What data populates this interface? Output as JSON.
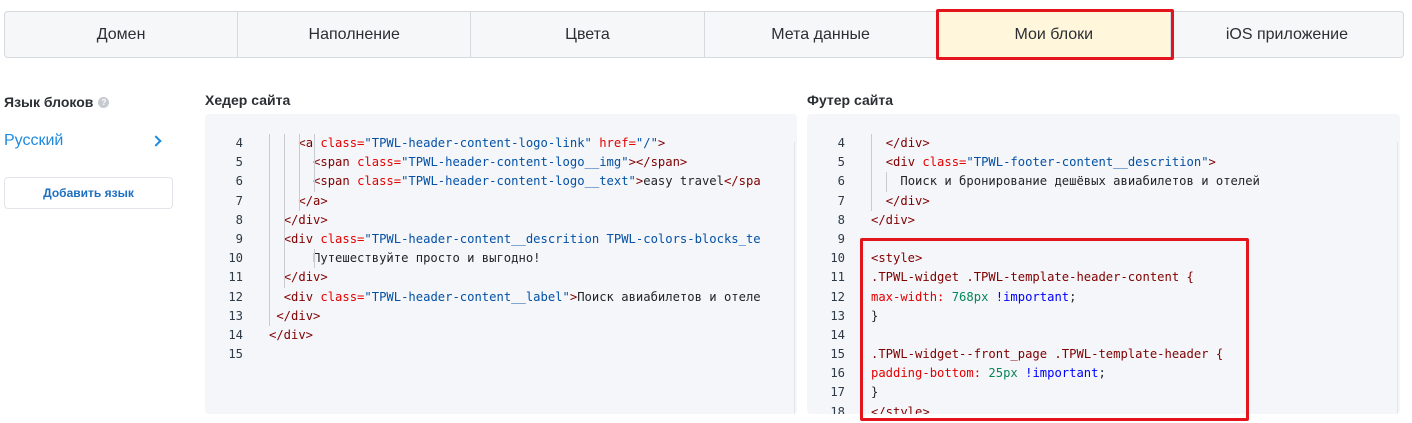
{
  "tabs": [
    {
      "label": "Домен"
    },
    {
      "label": "Наполнение"
    },
    {
      "label": "Цвета"
    },
    {
      "label": "Мета данные"
    },
    {
      "label": "Мои блоки"
    },
    {
      "label": "iOS приложение"
    }
  ],
  "active_tab": "Мои блоки",
  "left": {
    "title": "Язык блоков",
    "help": "?",
    "language": "Русский",
    "add_button": "Добавить язык"
  },
  "header_editor": {
    "title": "Хедер сайта",
    "lines": [
      {
        "n": "4",
        "segs": [
          [
            "    ",
            ""
          ],
          [
            "<a ",
            "tg"
          ],
          [
            "class=",
            "at"
          ],
          [
            "\"TPWL-header-content-logo-link\" ",
            "av"
          ],
          [
            "href=",
            "at"
          ],
          [
            "\"/\"",
            "av"
          ],
          [
            ">",
            "tg"
          ]
        ]
      },
      {
        "n": "5",
        "segs": [
          [
            "      ",
            ""
          ],
          [
            "<span ",
            "tg"
          ],
          [
            "class=",
            "at"
          ],
          [
            "\"TPWL-header-content-logo__img\"",
            "av"
          ],
          [
            "></span>",
            "tg"
          ]
        ]
      },
      {
        "n": "6",
        "segs": [
          [
            "      ",
            ""
          ],
          [
            "<span ",
            "tg"
          ],
          [
            "class=",
            "at"
          ],
          [
            "\"TPWL-header-content-logo__text\"",
            "av"
          ],
          [
            ">",
            "tg"
          ],
          [
            "easy travel",
            ""
          ],
          [
            "</spa",
            "tg"
          ]
        ]
      },
      {
        "n": "7",
        "segs": [
          [
            "    ",
            ""
          ],
          [
            "</a>",
            "tg"
          ]
        ]
      },
      {
        "n": "8",
        "segs": [
          [
            "  ",
            ""
          ],
          [
            "</div>",
            "tg"
          ]
        ]
      },
      {
        "n": "9",
        "segs": [
          [
            "  ",
            ""
          ],
          [
            "<div ",
            "tg"
          ],
          [
            "class=",
            "at"
          ],
          [
            "\"TPWL-header-content__descrition TPWL-colors-blocks_te",
            "av"
          ]
        ]
      },
      {
        "n": "10",
        "segs": [
          [
            "      ",
            ""
          ],
          [
            "Путешествуйте просто и выгодно!",
            ""
          ]
        ]
      },
      {
        "n": "11",
        "segs": [
          [
            "  ",
            ""
          ],
          [
            "</div>",
            "tg"
          ]
        ]
      },
      {
        "n": "12",
        "segs": [
          [
            "  ",
            ""
          ],
          [
            "<div ",
            "tg"
          ],
          [
            "class=",
            "at"
          ],
          [
            "\"TPWL-header-content__label\"",
            "av"
          ],
          [
            ">",
            "tg"
          ],
          [
            "Поиск авиабилетов и отеле",
            ""
          ]
        ]
      },
      {
        "n": "13",
        "segs": [
          [
            " ",
            ""
          ],
          [
            "</div>",
            "tg"
          ]
        ]
      },
      {
        "n": "14",
        "segs": [
          [
            "</div>",
            "tg"
          ]
        ]
      },
      {
        "n": "15",
        "segs": []
      }
    ]
  },
  "footer_editor": {
    "title": "Футер сайта",
    "lines": [
      {
        "n": "4",
        "segs": [
          [
            "  ",
            ""
          ],
          [
            "</div>",
            "tg"
          ]
        ]
      },
      {
        "n": "5",
        "segs": [
          [
            "  ",
            ""
          ],
          [
            "<div ",
            "tg"
          ],
          [
            "class=",
            "at"
          ],
          [
            "\"TPWL-footer-content__descrition\"",
            "av"
          ],
          [
            ">",
            "tg"
          ]
        ]
      },
      {
        "n": "6",
        "segs": [
          [
            "    ",
            ""
          ],
          [
            "Поиск и бронирование дешёвых авиабилетов и отелей",
            ""
          ]
        ]
      },
      {
        "n": "7",
        "segs": [
          [
            "  ",
            ""
          ],
          [
            "</div>",
            "tg"
          ]
        ]
      },
      {
        "n": "8",
        "segs": [
          [
            "</div>",
            "tg"
          ]
        ]
      },
      {
        "n": "9",
        "segs": []
      },
      {
        "n": "10",
        "segs": [
          [
            "<style>",
            "tg"
          ]
        ]
      },
      {
        "n": "11",
        "segs": [
          [
            ".TPWL-widget .TPWL-template-header-content {",
            "tg"
          ]
        ]
      },
      {
        "n": "12",
        "segs": [
          [
            "max-width: ",
            "at"
          ],
          [
            "768px",
            "nm"
          ],
          [
            " ",
            ""
          ],
          [
            "!important",
            "imp"
          ],
          [
            ";",
            ""
          ]
        ]
      },
      {
        "n": "13",
        "segs": [
          [
            "}",
            ""
          ]
        ]
      },
      {
        "n": "14",
        "segs": []
      },
      {
        "n": "15",
        "segs": [
          [
            ".TPWL-widget--front_page .TPWL-template-header {",
            "tg"
          ]
        ]
      },
      {
        "n": "16",
        "segs": [
          [
            "padding-bottom: ",
            "at"
          ],
          [
            "25px",
            "nm"
          ],
          [
            " ",
            ""
          ],
          [
            "!important",
            "imp"
          ],
          [
            ";",
            ""
          ]
        ]
      },
      {
        "n": "17",
        "segs": [
          [
            "}",
            ""
          ]
        ]
      },
      {
        "n": "18",
        "segs": [
          [
            "</style>",
            "tg"
          ]
        ]
      }
    ]
  },
  "colors": {
    "highlight": "#e3141c",
    "active_tab_bg": "#fff6dc",
    "link": "#1d8ae0"
  }
}
